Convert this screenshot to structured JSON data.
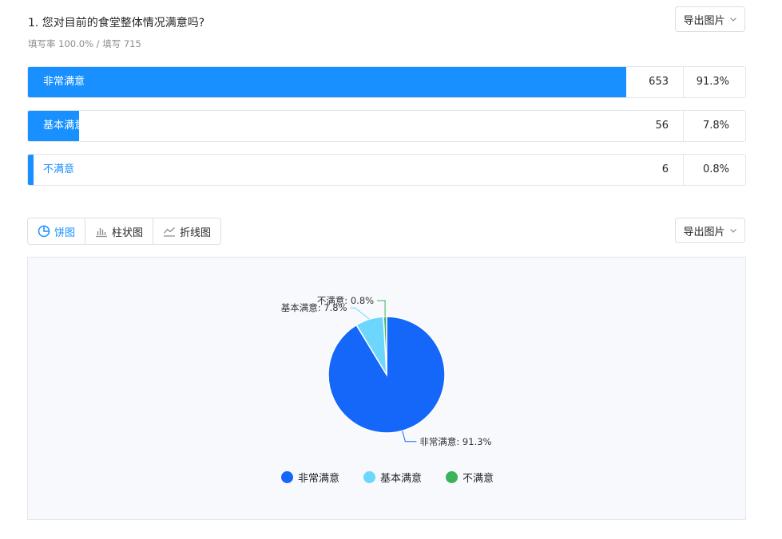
{
  "question": {
    "title": "1. 您对目前的食堂整体情况满意吗?",
    "meta": "填写率 100.0% / 填写 715"
  },
  "export_label": "导出图片",
  "results": [
    {
      "label": "非常满意",
      "count": "653",
      "percent": "91.3%",
      "fraction": 0.913
    },
    {
      "label": "基本满意",
      "count": "56",
      "percent": "7.8%",
      "fraction": 0.078
    },
    {
      "label": "不满意",
      "count": "6",
      "percent": "0.8%",
      "fraction": 0.008
    }
  ],
  "tabs": [
    {
      "label": "饼图",
      "icon": "pie-chart-icon",
      "active": true
    },
    {
      "label": "柱状图",
      "icon": "bar-chart-icon",
      "active": false
    },
    {
      "label": "折线图",
      "icon": "line-chart-icon",
      "active": false
    }
  ],
  "colors": {
    "accent": "#1890ff",
    "pie": [
      "#1467f9",
      "#6dd6fc",
      "#3bb358"
    ]
  },
  "chart_data": {
    "type": "pie",
    "categories": [
      "非常满意",
      "基本满意",
      "不满意"
    ],
    "values": [
      653,
      56,
      6
    ],
    "labels": [
      "非常满意: 91.3%",
      "基本满意: 7.8%",
      "不满意: 0.8%"
    ],
    "legend": "bottom"
  }
}
